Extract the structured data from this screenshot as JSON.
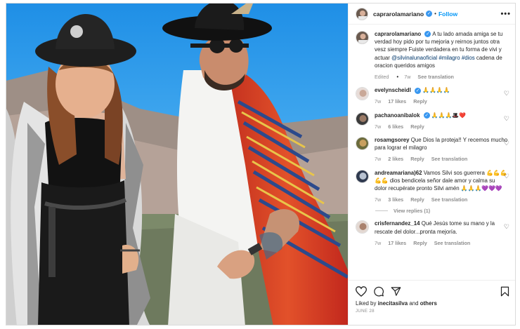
{
  "header": {
    "username": "caprarolamariano",
    "verified_mark": "✓",
    "separator": "•",
    "follow_label": "Follow",
    "more_label": "•••"
  },
  "caption": {
    "username": "caprarolamariano",
    "text_before": "A tu lado amada amiga se tu verdad hoy pido por tu mejoria y reirnos juntos otra vesz siempre Fuiste verdadera en tu forma de vivi y actuar ",
    "mention": "@silvinaluna",
    "mention_tail": "oficial",
    "hashtag1": "#milagro",
    "hashtag2": "#dios",
    "text_after": " cadena de oracion queridos amigos",
    "edited": "Edited",
    "age": "7w",
    "see_translation": "See translation"
  },
  "comments": [
    {
      "username": "evelynscheidl",
      "verified": true,
      "text": "🙏🙏🙏🙏",
      "age": "7w",
      "likes": "17 likes",
      "reply": "Reply",
      "translate": ""
    },
    {
      "username": "pachanoanibalok",
      "verified": true,
      "text": "🙏🙏🙏🎩❤️",
      "age": "7w",
      "likes": "6 likes",
      "reply": "Reply",
      "translate": ""
    },
    {
      "username": "rosamgsorey",
      "verified": false,
      "text": "Que Dios la proteja!! Y recemos mucho para lograr el milagro",
      "age": "7w",
      "likes": "2 likes",
      "reply": "Reply",
      "translate": "See translation"
    },
    {
      "username": "andreamariana)62",
      "verified": false,
      "text": "Vamos Silvi sos guerrera 💪💪💪💪💪 dios bendicela señor dale amor y calma su dolor recupérate pronto Silvi amén 🙏🙏🙏💜💜💜",
      "age": "7w",
      "likes": "3 likes",
      "reply": "Reply",
      "translate": "See translation"
    },
    {
      "username": "crisfernandez_14",
      "verified": false,
      "text": "Qué Jesús tome su mano y la rescate del dolor...pronta mejoría.",
      "age": "7w",
      "likes": "17 likes",
      "reply": "Reply",
      "translate": "See translation"
    }
  ],
  "view_replies": "View replies (1)",
  "footer": {
    "liked_prefix": "Liked by ",
    "liked_user": "inecitasilva",
    "liked_mid": " and ",
    "liked_others": "others",
    "date": "JUNE 28"
  },
  "icons": {
    "heart": "heart-icon",
    "comment": "comment-icon",
    "share": "share-icon",
    "save": "bookmark-icon",
    "more": "more-icon"
  },
  "colors": {
    "link": "#0095f6",
    "verified": "#3897f0",
    "tag": "#00376b",
    "muted": "#8e8e8e"
  }
}
